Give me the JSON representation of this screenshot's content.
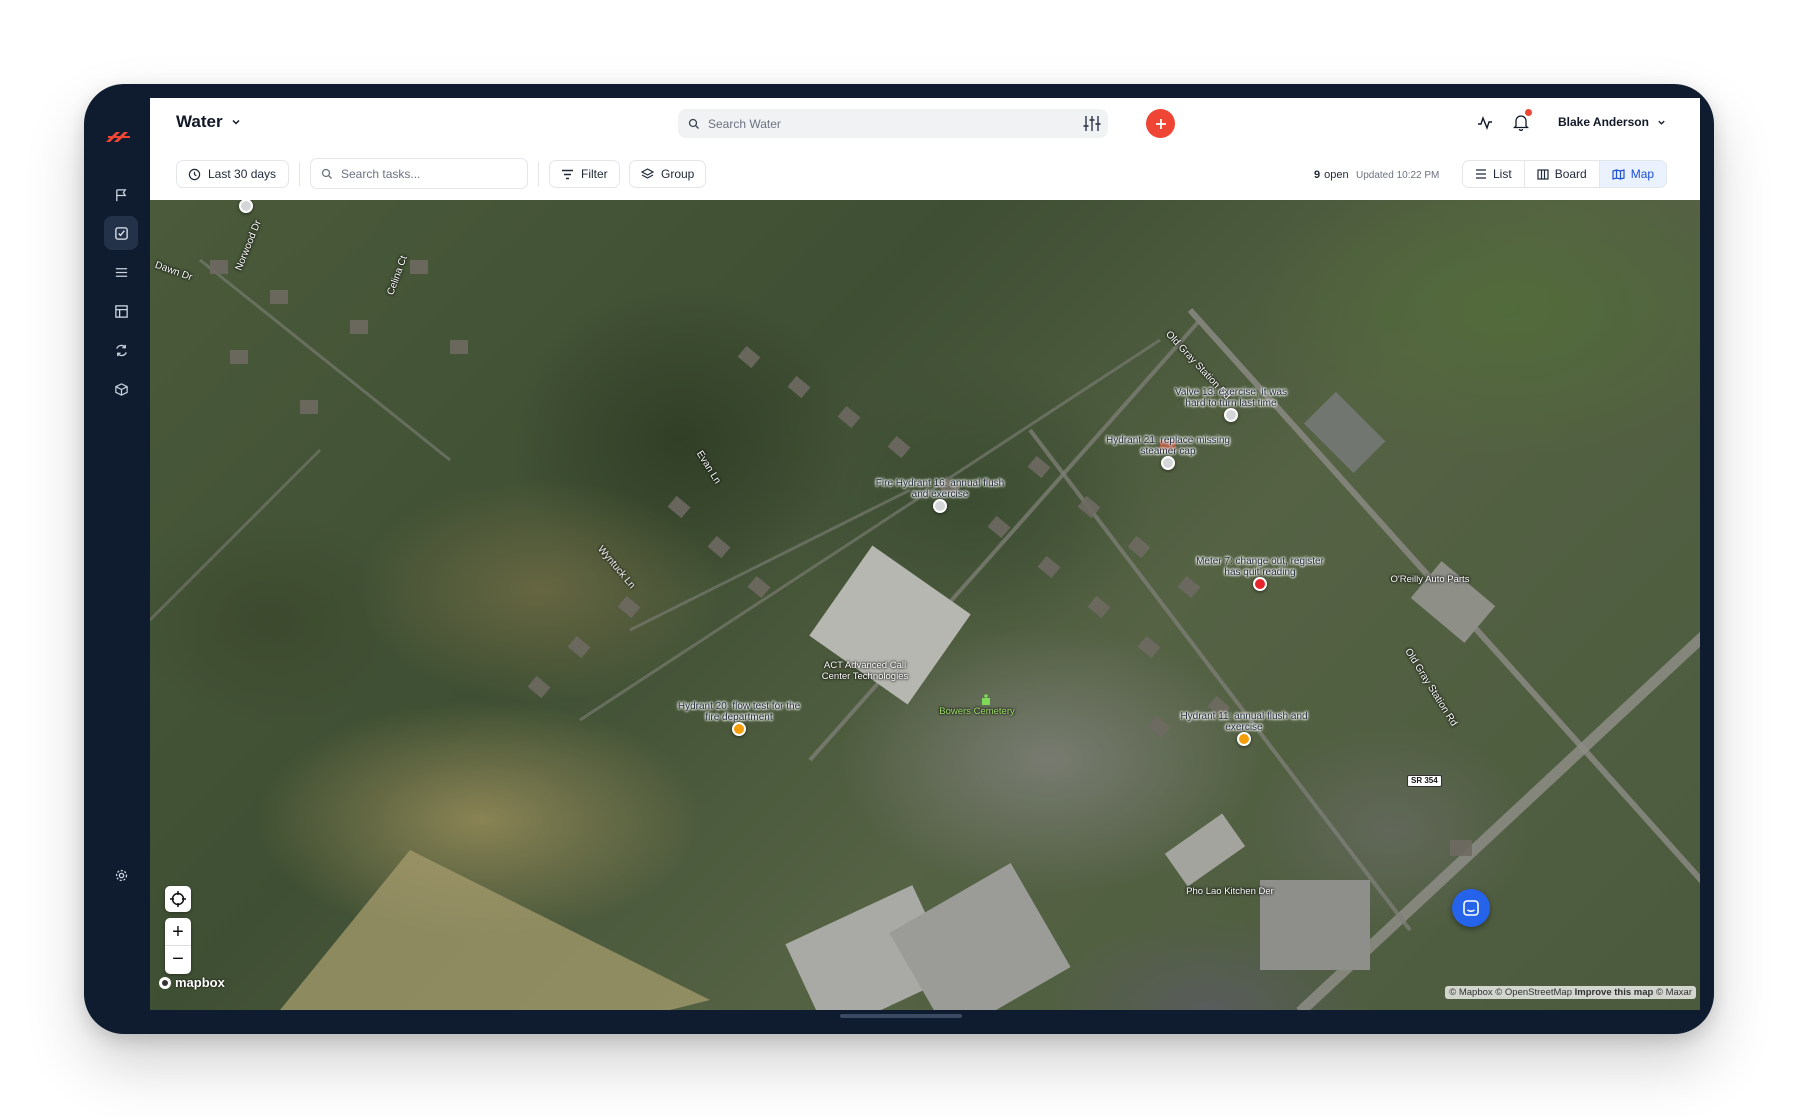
{
  "header": {
    "app_title": "Water",
    "search_placeholder": "Search Water",
    "user_name": "Blake Anderson"
  },
  "toolbar": {
    "date_range": "Last 30 days",
    "task_search_placeholder": "Search tasks...",
    "filter_label": "Filter",
    "group_label": "Group",
    "open_count": "9",
    "open_label": "open",
    "updated": "Updated 10:22 PM",
    "views": [
      {
        "label": "List",
        "active": false
      },
      {
        "label": "Board",
        "active": false
      },
      {
        "label": "Map",
        "active": true
      }
    ]
  },
  "sidebar": {
    "items": [
      {
        "icon": "flag-icon",
        "active": false
      },
      {
        "icon": "check-square-icon",
        "active": true
      },
      {
        "icon": "list-icon",
        "active": false
      },
      {
        "icon": "table-icon",
        "active": false
      },
      {
        "icon": "repeat-icon",
        "active": false
      },
      {
        "icon": "box-icon",
        "active": false
      }
    ],
    "settings_icon": "gear-icon"
  },
  "map": {
    "markers": [
      {
        "label": "Valve 13: exercise, it was hard to turn last time",
        "status_color": "#d4d6d8"
      },
      {
        "label": "Hydrant 21: replace missing steamer cap",
        "status_color": "#d4d6d8"
      },
      {
        "label": "Fire Hydrant 16: annual flush and exercise",
        "status_color": "#d4d6d8"
      },
      {
        "label": "Meter 7: change out, register has quit reading",
        "status_color": "#e5242b"
      },
      {
        "label": "Hydrant 20: flow test for the fire department",
        "status_color": "#f59e0b"
      },
      {
        "label": "Hydrant 11: annual flush and exercise",
        "status_color": "#f59e0b"
      },
      {
        "label": "",
        "status_color": "#d4d6d8"
      }
    ],
    "road_labels": {
      "dawn": "Dawn Dr",
      "norwood": "Norwood Dr",
      "celina": "Celina Ct",
      "evan": "Evan Ln",
      "wyntuck": "Wyntuck Ln",
      "old_gray_1": "Old Gray Station Rd",
      "old_gray_2": "Old Gray Station Rd",
      "sr354": "SR 354"
    },
    "place_labels": {
      "act": "ACT Advanced Call Center Technologies",
      "cemetery": "Bowers Cemetery",
      "oreilly": "O'Reilly Auto Parts",
      "pho": "Pho Lao Kitchen Der"
    },
    "logo": "mapbox",
    "attribution": {
      "mapbox": "© Mapbox",
      "osm": "© OpenStreetMap",
      "improve": "Improve this map",
      "maxar": "© Maxar"
    },
    "controls": {
      "zoom_in": "+",
      "zoom_out": "−"
    }
  },
  "colors": {
    "accent": "#ef4535",
    "frame": "#0f1b2e",
    "active_view": "#1d4ed8",
    "chat": "#2563eb"
  }
}
